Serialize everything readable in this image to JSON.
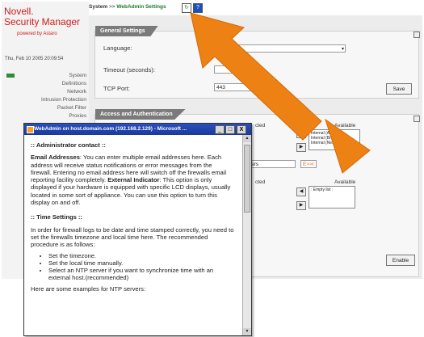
{
  "brand": {
    "line1": "Novell.",
    "line2": "Security Manager",
    "powered": "powered by Astaro"
  },
  "sidebar": {
    "date": "Thu, Feb 10 2005 20:09:54",
    "items": [
      "System",
      "Definitions",
      "Network",
      "Intrusion Protection",
      "Packet Filter",
      "Proxies"
    ]
  },
  "topbar": {
    "crumb_a": "System",
    "crumb_sep": ">>",
    "crumb_b": "WebAdmin Settings"
  },
  "general": {
    "title": "General Settings",
    "language_label": "Language:",
    "timeout_label": "Timeout (seconds):",
    "tcp_label": "TCP Port:",
    "tcp_value": "443",
    "save": "Save"
  },
  "access": {
    "title": "Access and Authentication",
    "selected_partial": "cted",
    "available": "Available",
    "available_items": [
      "Internal (Address)",
      "Internal (Broadcast)",
      "Internal (Network)"
    ],
    "users_partial": "ers",
    "flag": "E>>I",
    "selected_partial2": "cted",
    "available2": "Available",
    "empty": ": Empty list :",
    "enable": "Enable"
  },
  "popup": {
    "title": "WebAdmin on host.domain.com (192.168.2.129) - Microsoft ...",
    "min": "_",
    "max": "□",
    "close": "X",
    "h1": ":: Administrator contact ::",
    "p1_bold": "Email Addresses",
    "p1": ": You can enter multiple email addresses here. Each address will receive status notifications or error messages from the firewall. Entering no email address here will switch off the firewalls email reporting facility completely.",
    "p2_bold": "External Indicator",
    "p2": ": This option is only displayed if your hardware is equipped with specific LCD displays, usually located in some sort of appliance. You can use this option to turn this display on and off.",
    "h2": ":: Time Settings ::",
    "p3": "In order for firewall logs to be date and time stamped correctly, you need to set the firewalls timezone and local time here. The recommended procedure is as follows:",
    "bullets": [
      "Set the timezone.",
      "Set the local time manually.",
      "Select an NTP server if you want to synchronize time with an external host.(recommended)"
    ],
    "p4": "Here are some examples for NTP servers:"
  },
  "colors": {
    "brand": "#d11b1b",
    "arrow": "#ee8114",
    "titlebar": "#1a3a9a",
    "panel_title": "#7a7a7a",
    "nav_active": "#2f8a3b"
  }
}
